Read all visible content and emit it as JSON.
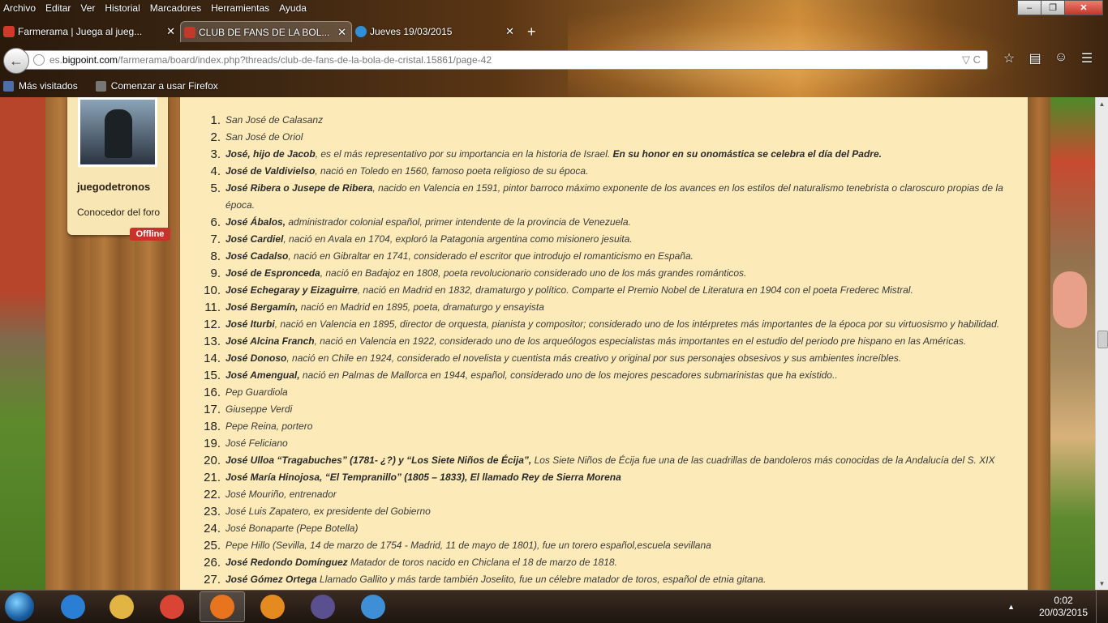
{
  "menubar": {
    "items": [
      "Archivo",
      "Editar",
      "Ver",
      "Historial",
      "Marcadores",
      "Herramientas",
      "Ayuda"
    ]
  },
  "window_controls": {
    "minimize": "–",
    "maximize": "❐",
    "close": "✕"
  },
  "tabs": [
    {
      "label": "Farmerama | Juega al jueg...",
      "icon_color": "#d13a2a",
      "active": false
    },
    {
      "label": "CLUB DE FANS DE LA BOL...",
      "icon_color": "#c0392b",
      "active": true
    },
    {
      "label": "Jueves 19/03/2015",
      "icon_color": "#2f8fd8",
      "active": false
    }
  ],
  "newtab": "+",
  "tab_close": "✕",
  "urlbar": {
    "prefix": "es.",
    "host": "bigpoint.com",
    "path": "/farmerama/board/index.php?threads/club-de-fans-de-la-bola-de-cristal.15861/page-42",
    "reload": "▽ C"
  },
  "nav_icons": [
    "star-icon",
    "reader-icon",
    "smile-icon",
    "menu-icon"
  ],
  "bookmarks": {
    "items": [
      "Más visitados",
      "Comenzar a usar Firefox"
    ]
  },
  "user": {
    "name": "juegodetronos",
    "title": "Conocedor del foro",
    "status": "Offline"
  },
  "list": [
    {
      "n": "1.",
      "b": "",
      "t": "San José de Calasanz",
      "b2": ""
    },
    {
      "n": "2.",
      "b": "",
      "t": "San José de Oriol",
      "b2": ""
    },
    {
      "n": "3.",
      "b": "José, hijo de Jacob",
      "t": ", es el más representativo por su importancia en la historia de Israel. ",
      "b2": "En su honor en su onomástica se celebra el día del Padre."
    },
    {
      "n": "4.",
      "b": "José de Valdivielso",
      "t": ", nació en Toledo en 1560, famoso poeta religioso de su época.",
      "b2": ""
    },
    {
      "n": "5.",
      "b": "José Ribera o Jusepe de Ribera",
      "t": ", nacido en Valencia en 1591, pintor barroco máximo exponente de los avances en los estilos del naturalismo tenebrista o claroscuro propias de la época.",
      "b2": ""
    },
    {
      "n": "6.",
      "b": "José Ábalos,",
      "t": " administrador colonial español, primer intendente de la provincia de Venezuela.",
      "b2": ""
    },
    {
      "n": "7.",
      "b": "José Cardiel",
      "t": ", nació en Avala en 1704, exploró la Patagonia argentina como misionero jesuita.",
      "b2": ""
    },
    {
      "n": "8.",
      "b": "José Cadalso",
      "t": ", nació en Gibraltar en 1741, considerado el escritor que introdujo el romanticismo en España.",
      "b2": ""
    },
    {
      "n": "9.",
      "b": "José de Espronceda",
      "t": ", nació en Badajoz en 1808, poeta revolucionario considerado uno de los más grandes románticos.",
      "b2": ""
    },
    {
      "n": "10.",
      "b": "José Echegaray y Eizaguirre",
      "t": ", nació en Madrid en 1832, dramaturgo y político. Comparte el Premio Nobel de Literatura en 1904 con el poeta Frederec Mistral.",
      "b2": ""
    },
    {
      "n": "11.",
      "b": "José Bergamín,",
      "t": " nació en Madrid en 1895, poeta, dramaturgo y ensayista",
      "b2": ""
    },
    {
      "n": "12.",
      "b": "José Iturbi",
      "t": ", nació en Valencia en 1895, director de orquesta, pianista y compositor; considerado uno de los intérpretes más importantes de la época por su virtuosismo y habilidad.",
      "b2": ""
    },
    {
      "n": "13.",
      "b": "José Alcina Franch",
      "t": ", nació en Valencia en 1922, considerado uno de los arqueólogos especialistas más importantes en el estudio del periodo pre hispano en las Américas.",
      "b2": ""
    },
    {
      "n": "14.",
      "b": "José Donoso",
      "t": ", nació en Chile en 1924, considerado el novelista y cuentista más creativo y original por sus personajes obsesivos y sus ambientes increíbles.",
      "b2": ""
    },
    {
      "n": "15.",
      "b": "José Amengual,",
      "t": " nació en Palmas de Mallorca en 1944, español, considerado uno de los mejores pescadores submarinistas que ha existido..",
      "b2": ""
    },
    {
      "n": "16.",
      "b": "",
      "t": "Pep Guardiola",
      "b2": ""
    },
    {
      "n": "17.",
      "b": "",
      "t": "Giuseppe Verdi",
      "b2": ""
    },
    {
      "n": "18.",
      "b": "",
      "t": "Pepe Reina, portero",
      "b2": ""
    },
    {
      "n": "19.",
      "b": "",
      "t": "José Feliciano",
      "b2": ""
    },
    {
      "n": "20.",
      "b": "José Ulloa “Tragabuches” (1781- ¿?) y “Los Siete Niños de Écija”,",
      "t": " Los Siete Niños de Écija fue una de las cuadrillas de bandoleros más conocidas de la Andalucía del S. XIX",
      "b2": ""
    },
    {
      "n": "21.",
      "b": "José María Hinojosa, “El Tempranillo” (1805 – 1833), El llamado Rey de Sierra Morena",
      "t": "",
      "b2": ""
    },
    {
      "n": "22.",
      "b": "",
      "t": "José Mouriño, entrenador",
      "b2": ""
    },
    {
      "n": "23.",
      "b": "",
      "t": "José Luis Zapatero, ex presidente del Gobierno",
      "b2": ""
    },
    {
      "n": "24.",
      "b": "",
      "t": "José Bonaparte (Pepe Botella)",
      "b2": ""
    },
    {
      "n": "25.",
      "b": "",
      "t": "Pepe Hillo (Sevilla, 14 de marzo de 1754 - Madrid, 11 de mayo de 1801), fue un torero español,escuela sevillana",
      "b2": ""
    },
    {
      "n": "26.",
      "b": "José Redondo Domínguez",
      "t": " Matador de toros nacido en Chiclana el 18 de marzo de 1818.",
      "b2": ""
    },
    {
      "n": "27.",
      "b": "José Gómez Ortega",
      "t": " Llamado Gallito y más tarde también Joselito, fue un célebre matador de toros, español de etnia gitana.",
      "b2": ""
    }
  ],
  "taskbar": {
    "apps": [
      {
        "name": "ie-icon",
        "color": "#2a7fd4"
      },
      {
        "name": "explorer-icon",
        "color": "#e1b443"
      },
      {
        "name": "chrome-icon",
        "color": "#d94435"
      },
      {
        "name": "firefox-icon",
        "color": "#e8741e",
        "active": true
      },
      {
        "name": "media-icon",
        "color": "#e58a1f"
      },
      {
        "name": "app-icon",
        "color": "#5a4f8f"
      },
      {
        "name": "paint-icon",
        "color": "#3f8fd6"
      }
    ]
  },
  "clock": {
    "time": "0:02",
    "date": "20/03/2015"
  },
  "tray_toggle": "▲"
}
